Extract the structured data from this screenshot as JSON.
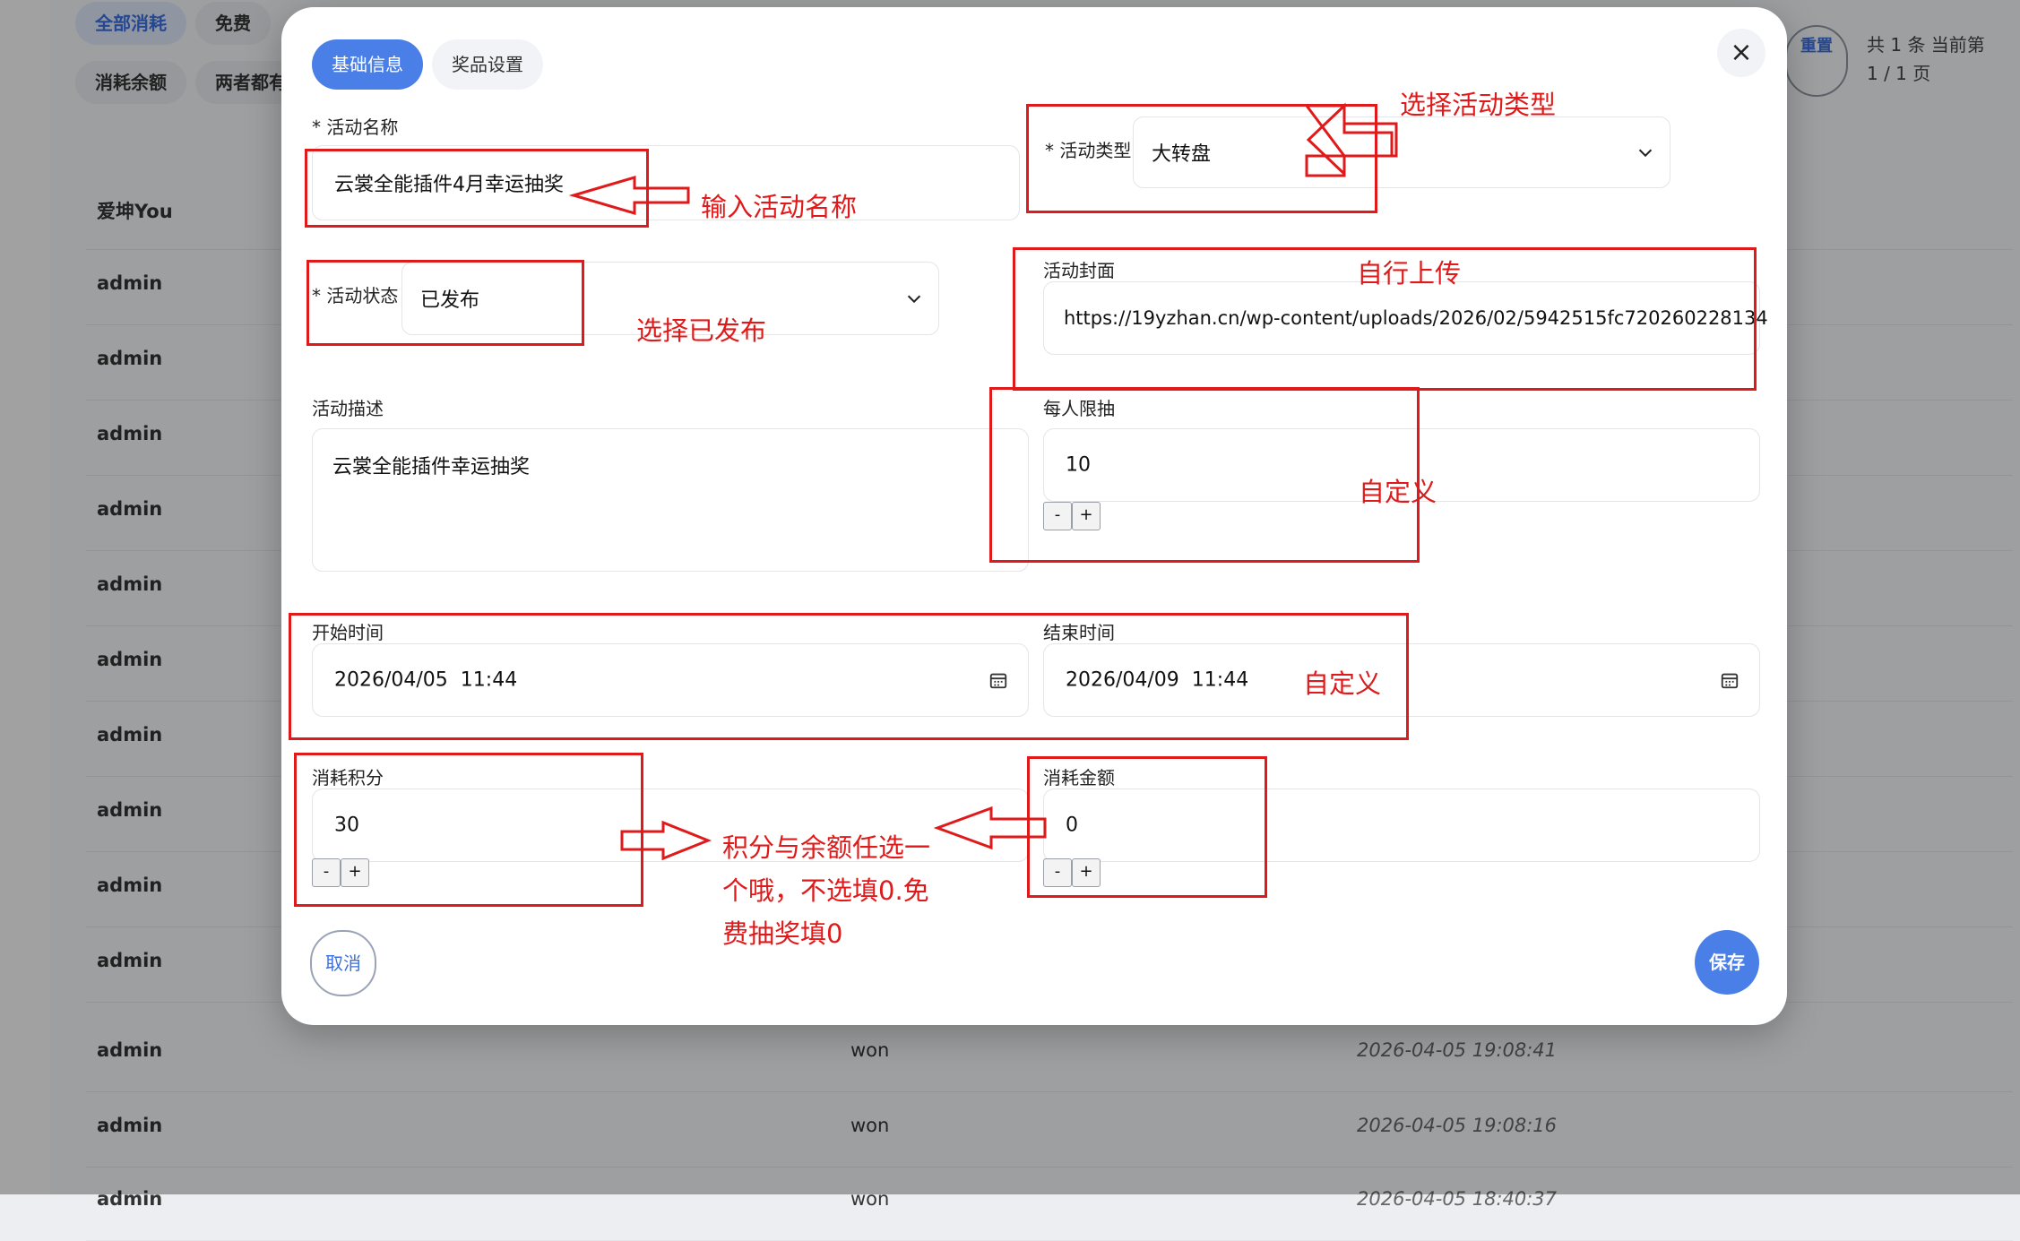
{
  "background": {
    "filter_chips": [
      "全部消耗",
      "免费",
      "消耗余额",
      "两者都有"
    ],
    "reset_label": "重置",
    "page_info_line1": "共 1 条 当前第",
    "page_info_line2": "1 / 1 页",
    "rows": [
      {
        "user": "爱坤You",
        "status": "",
        "time": ""
      },
      {
        "user": "admin",
        "status": "",
        "time": ""
      },
      {
        "user": "admin",
        "status": "",
        "time": ""
      },
      {
        "user": "admin",
        "status": "",
        "time": ""
      },
      {
        "user": "admin",
        "status": "",
        "time": ""
      },
      {
        "user": "admin",
        "status": "",
        "time": ""
      },
      {
        "user": "admin",
        "status": "",
        "time": ""
      },
      {
        "user": "admin",
        "status": "",
        "time": ""
      },
      {
        "user": "admin",
        "status": "",
        "time": ""
      },
      {
        "user": "admin",
        "status": "",
        "time": ""
      },
      {
        "user": "admin",
        "status": "",
        "time": ""
      },
      {
        "user": "admin",
        "status": "won",
        "time": "2026-04-05 19:08:41"
      },
      {
        "user": "admin",
        "status": "won",
        "time": "2026-04-05 19:08:16"
      },
      {
        "user": "admin",
        "status": "won",
        "time": "2026-04-05 18:40:37"
      }
    ]
  },
  "modal": {
    "tabs": [
      "基础信息",
      "奖品设置"
    ],
    "close_icon": "×",
    "activity_name": {
      "label": "* 活动名称",
      "value": "云裳全能插件4月幸运抽奖"
    },
    "activity_type": {
      "label": "* 活动类型",
      "value": "大转盘"
    },
    "activity_status": {
      "label": "* 活动状态",
      "value": "已发布"
    },
    "cover": {
      "label": "活动封面",
      "value": "https://19yzhan.cn/wp-content/uploads/2026/02/5942515fc720260228134"
    },
    "description": {
      "label": "活动描述",
      "value": "云裳全能插件幸运抽奖"
    },
    "per_user_limit": {
      "label": "每人限抽",
      "value": "10"
    },
    "start_time": {
      "label": "开始时间",
      "value": "2026/04/05  11:44"
    },
    "end_time": {
      "label": "结束时间",
      "value": "2026/04/09  11:44"
    },
    "cost_points": {
      "label": "消耗积分",
      "value": "30"
    },
    "cost_balance": {
      "label": "消耗金额",
      "value": "0"
    },
    "stepper_minus": "-",
    "stepper_plus": "+",
    "cancel_label": "取消",
    "save_label": "保存"
  },
  "annotations": {
    "select_type": "选择活动类型",
    "enter_name": "输入活动名称",
    "self_upload": "自行上传",
    "select_published": "选择已发布",
    "custom_limit": "自定义",
    "custom_time": "自定义",
    "points_note_line1": "积分与余额任选一",
    "points_note_line2": "个哦，不选填0.免",
    "points_note_line3": "费抽奖填0"
  },
  "colors": {
    "accent": "#4a7fe8",
    "annotation_red": "#e01a1a"
  }
}
